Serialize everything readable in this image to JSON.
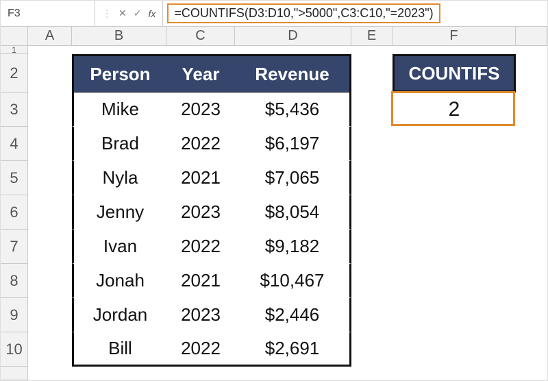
{
  "namebox": "F3",
  "formula": "=COUNTIFS(D3:D10,\">5000\",C3:C10,\"=2023\")",
  "columns": [
    "A",
    "B",
    "C",
    "D",
    "E",
    "F"
  ],
  "rows": [
    "1",
    "2",
    "3",
    "4",
    "5",
    "6",
    "7",
    "8",
    "9",
    "10"
  ],
  "table": {
    "headers": {
      "person": "Person",
      "year": "Year",
      "revenue": "Revenue"
    },
    "data": [
      {
        "person": "Mike",
        "year": "2023",
        "revenue": "$5,436"
      },
      {
        "person": "Brad",
        "year": "2022",
        "revenue": "$6,197"
      },
      {
        "person": "Nyla",
        "year": "2021",
        "revenue": "$7,065"
      },
      {
        "person": "Jenny",
        "year": "2023",
        "revenue": "$8,054"
      },
      {
        "person": "Ivan",
        "year": "2022",
        "revenue": "$9,182"
      },
      {
        "person": "Jonah",
        "year": "2021",
        "revenue": "$10,467"
      },
      {
        "person": "Jordan",
        "year": "2023",
        "revenue": "$2,446"
      },
      {
        "person": "Bill",
        "year": "2022",
        "revenue": "$2,691"
      }
    ]
  },
  "countifs": {
    "label": "COUNTIFS",
    "value": "2"
  },
  "icons": {
    "dropdown": "⌄",
    "cancel": "✕",
    "confirm": "✓",
    "fx": "fx"
  },
  "colors": {
    "accent_orange": "#e08a2e",
    "header_navy": "#35456b"
  }
}
